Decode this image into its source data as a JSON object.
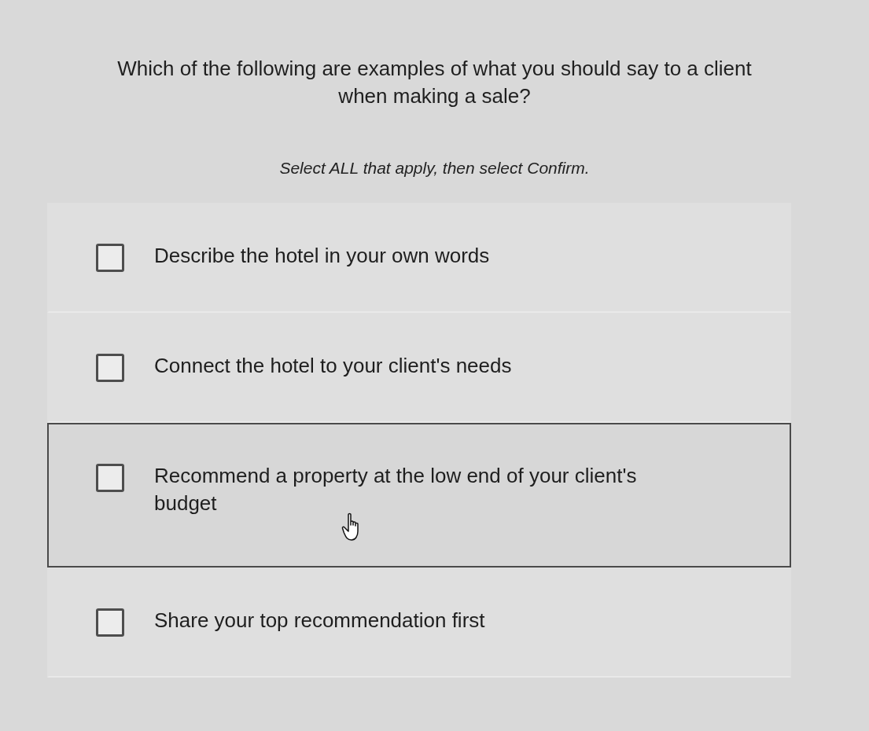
{
  "question": {
    "text": "Which of the following are examples of what you should say to a client when making a sale?",
    "instruction": "Select ALL that apply, then select Confirm."
  },
  "options": [
    {
      "label": "Describe the hotel in your own words",
      "checked": false,
      "hovered": false
    },
    {
      "label": "Connect the hotel to your client's needs",
      "checked": false,
      "hovered": false
    },
    {
      "label": "Recommend a property at the low end of your client's budget",
      "checked": false,
      "hovered": true
    },
    {
      "label": "Share your top recommendation first",
      "checked": false,
      "hovered": false
    }
  ]
}
